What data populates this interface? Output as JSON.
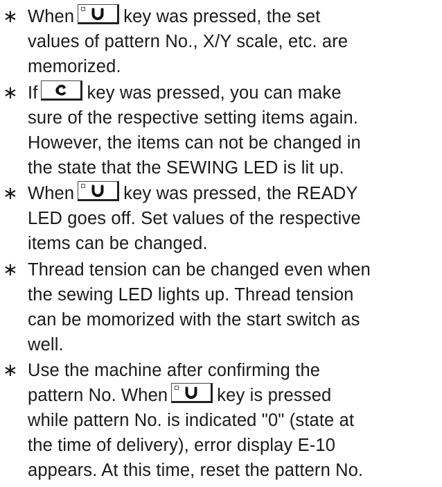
{
  "bullet_glyph": "∗",
  "icons": {
    "ready_key": "ready-key-icon",
    "reset_key": "reset-key-icon"
  },
  "notes": [
    {
      "lines": [
        {
          "before": "When",
          "key": "ready",
          "after": "key was pressed, the set"
        },
        {
          "text": "values of pattern No., X/Y scale, etc. are"
        },
        {
          "text": "memorized."
        }
      ]
    },
    {
      "lines": [
        {
          "before": "If",
          "key": "reset",
          "after": "key was pressed, you can make"
        },
        {
          "text": "sure of the respective setting items again."
        },
        {
          "text": "However, the items can not be changed in"
        },
        {
          "text": "the state that the SEWING LED is lit up."
        }
      ]
    },
    {
      "lines": [
        {
          "before": "When",
          "key": "ready",
          "after": "key was pressed, the READY"
        },
        {
          "text": "LED goes off. Set values of the respective"
        },
        {
          "text": "items can be changed."
        }
      ]
    },
    {
      "lines": [
        {
          "text": "Thread tension can be changed even when"
        },
        {
          "text": "the sewing LED lights up. Thread tension"
        },
        {
          "text": "can be momorized with the start switch as"
        },
        {
          "text": "well."
        }
      ]
    },
    {
      "lines": [
        {
          "text": "Use the machine after confirming the"
        },
        {
          "before": "pattern No. When",
          "key": "ready",
          "after": "key is pressed"
        },
        {
          "text": "while pattern No. is indicated \"0\" (state at"
        },
        {
          "text": "the time of delivery), error display E-10"
        },
        {
          "text": "appears. At this time, reset the pattern No."
        }
      ]
    }
  ]
}
